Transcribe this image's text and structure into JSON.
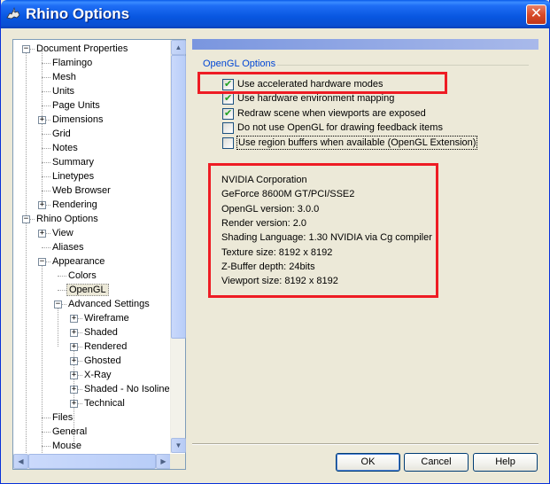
{
  "window": {
    "title": "Rhino Options",
    "close_glyph": "✕"
  },
  "tree": {
    "items": [
      {
        "label": "Document Properties",
        "level": 0,
        "exp": "−"
      },
      {
        "label": "Flamingo",
        "level": 1,
        "exp": ""
      },
      {
        "label": "Mesh",
        "level": 1,
        "exp": ""
      },
      {
        "label": "Units",
        "level": 1,
        "exp": ""
      },
      {
        "label": "Page Units",
        "level": 1,
        "exp": ""
      },
      {
        "label": "Dimensions",
        "level": 1,
        "exp": "+"
      },
      {
        "label": "Grid",
        "level": 1,
        "exp": ""
      },
      {
        "label": "Notes",
        "level": 1,
        "exp": ""
      },
      {
        "label": "Summary",
        "level": 1,
        "exp": ""
      },
      {
        "label": "Linetypes",
        "level": 1,
        "exp": ""
      },
      {
        "label": "Web Browser",
        "level": 1,
        "exp": ""
      },
      {
        "label": "Rendering",
        "level": 1,
        "exp": "+"
      },
      {
        "label": "Rhino Options",
        "level": 0,
        "exp": "−"
      },
      {
        "label": "View",
        "level": 1,
        "exp": "+"
      },
      {
        "label": "Aliases",
        "level": 1,
        "exp": ""
      },
      {
        "label": "Appearance",
        "level": 1,
        "exp": "−"
      },
      {
        "label": "Colors",
        "level": 2,
        "exp": ""
      },
      {
        "label": "OpenGL",
        "level": 2,
        "exp": "",
        "selected": true
      },
      {
        "label": "Advanced Settings",
        "level": 2,
        "exp": "−"
      },
      {
        "label": "Wireframe",
        "level": 3,
        "exp": "+"
      },
      {
        "label": "Shaded",
        "level": 3,
        "exp": "+"
      },
      {
        "label": "Rendered",
        "level": 3,
        "exp": "+"
      },
      {
        "label": "Ghosted",
        "level": 3,
        "exp": "+"
      },
      {
        "label": "X-Ray",
        "level": 3,
        "exp": "+"
      },
      {
        "label": "Shaded - No Isoline",
        "level": 3,
        "exp": "+"
      },
      {
        "label": "Technical",
        "level": 3,
        "exp": "+"
      },
      {
        "label": "Files",
        "level": 1,
        "exp": ""
      },
      {
        "label": "General",
        "level": 1,
        "exp": ""
      },
      {
        "label": "Mouse",
        "level": 1,
        "exp": ""
      }
    ]
  },
  "opengl": {
    "group_label": "OpenGL Options",
    "options": [
      {
        "label": "Use accelerated hardware modes",
        "checked": true,
        "focused": false
      },
      {
        "label": "Use hardware environment mapping",
        "checked": true,
        "focused": false
      },
      {
        "label": "Redraw scene when viewports are exposed",
        "checked": true,
        "focused": false
      },
      {
        "label": "Do not use OpenGL for drawing feedback items",
        "checked": false,
        "focused": false
      },
      {
        "label": "Use region buffers when available (OpenGL Extension)",
        "checked": false,
        "focused": true
      }
    ],
    "info": [
      "NVIDIA Corporation",
      "GeForce 8600M GT/PCI/SSE2",
      "OpenGL version: 3.0.0",
      "Render version: 2.0",
      "Shading Language: 1.30 NVIDIA via Cg compiler",
      "Texture size: 8192 x 8192",
      "Z-Buffer depth: 24bits",
      "Viewport size: 8192 x 8192"
    ]
  },
  "buttons": {
    "ok": "OK",
    "cancel": "Cancel",
    "help": "Help"
  },
  "colors": {
    "highlight_box": "#ee1c24",
    "group_label": "#0046d5"
  }
}
